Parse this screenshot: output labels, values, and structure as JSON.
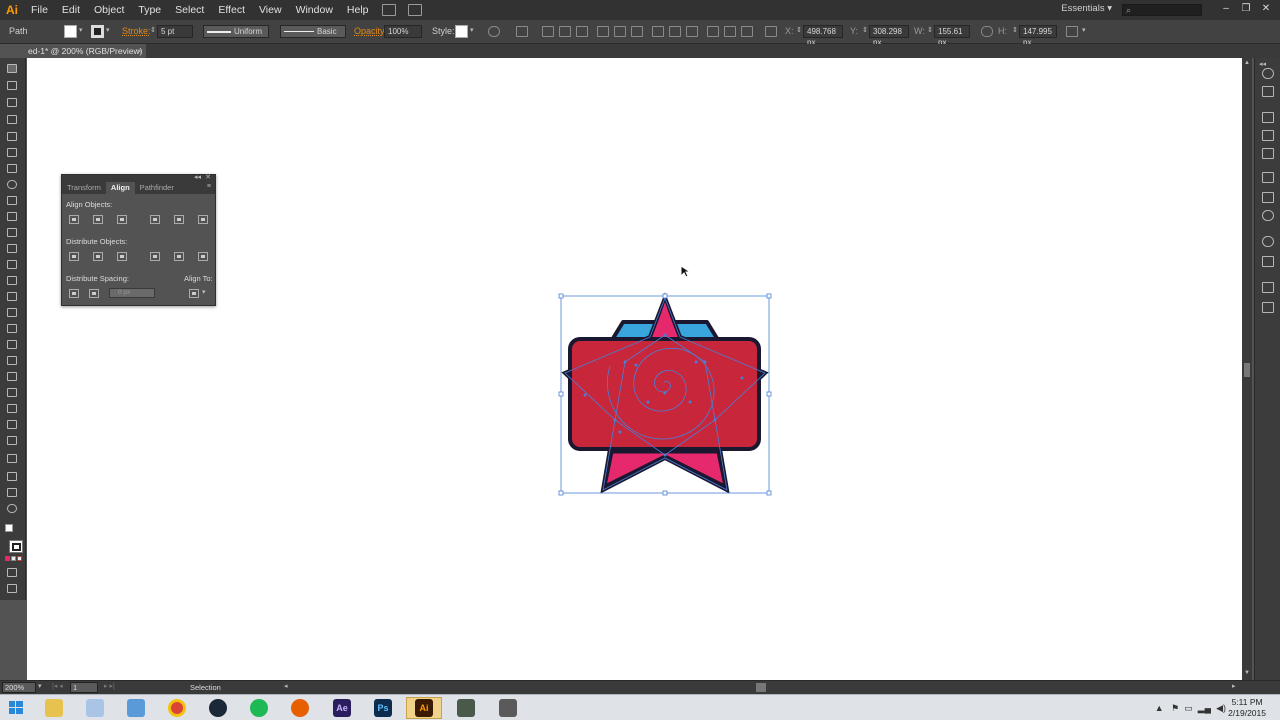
{
  "app": {
    "logo": "Ai",
    "workspace": "Essentials"
  },
  "menu": [
    "File",
    "Edit",
    "Object",
    "Type",
    "Select",
    "Effect",
    "View",
    "Window",
    "Help"
  ],
  "control_bar": {
    "selection_type": "Path",
    "stroke_label": "Stroke:",
    "stroke_weight": "5 pt",
    "stroke_profile": "Uniform",
    "brush": "Basic",
    "opacity_label": "Opacity:",
    "opacity": "100%",
    "style_label": "Style:",
    "x_label": "X:",
    "x_value": "498.768 px",
    "y_label": "Y:",
    "y_value": "308.298 px",
    "w_label": "W:",
    "w_value": "155.61 px",
    "h_label": "H:",
    "h_value": "147.995 px"
  },
  "document_tab": {
    "title": "ed-1* @ 200% (RGB/Preview)",
    "close": "×"
  },
  "align_panel": {
    "tabs": [
      "Transform",
      "Align",
      "Pathfinder"
    ],
    "active_tab": "Align",
    "align_objects_label": "Align Objects:",
    "distribute_objects_label": "Distribute Objects:",
    "distribute_spacing_label": "Distribute Spacing:",
    "align_to_label": "Align To:",
    "spacing_value": "0 px"
  },
  "status_bar": {
    "zoom": "200%",
    "page": "1",
    "mode": "Selection"
  },
  "taskbar": {
    "apps": [
      {
        "name": "file-explorer",
        "label": ""
      },
      {
        "name": "paint",
        "label": ""
      },
      {
        "name": "documents",
        "label": ""
      },
      {
        "name": "chrome",
        "label": ""
      },
      {
        "name": "steam",
        "label": ""
      },
      {
        "name": "spotify",
        "label": ""
      },
      {
        "name": "firefox",
        "label": ""
      },
      {
        "name": "after-effects",
        "label": "Ae"
      },
      {
        "name": "photoshop",
        "label": "Ps"
      },
      {
        "name": "illustrator",
        "label": "Ai"
      },
      {
        "name": "tool-a",
        "label": ""
      },
      {
        "name": "tool-b",
        "label": ""
      }
    ],
    "time": "5:11 PM",
    "date": "2/19/2015"
  },
  "colors": {
    "badge_fill": "#c8263a",
    "star_fill": "#e6286c",
    "accent_blue": "#38a6dc",
    "outline": "#1a1730",
    "selection": "#4a7fd8",
    "illustrator_orange": "#ff9a00"
  }
}
